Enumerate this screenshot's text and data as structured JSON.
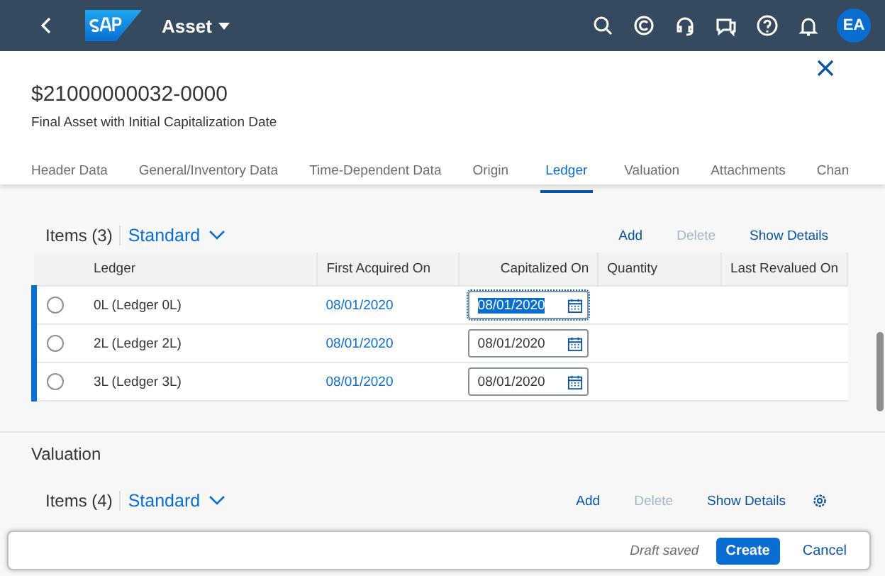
{
  "shell": {
    "app_title": "Asset",
    "avatar": "EA"
  },
  "header": {
    "title": "$21000000032-0000",
    "subtitle": "Final Asset with Initial Capitalization Date"
  },
  "tabs": [
    {
      "label": "Header Data",
      "selected": false
    },
    {
      "label": "General/Inventory Data",
      "selected": false
    },
    {
      "label": "Time-Dependent Data",
      "selected": false
    },
    {
      "label": "Origin",
      "selected": false
    },
    {
      "label": "Ledger",
      "selected": true
    },
    {
      "label": "Valuation",
      "selected": false
    },
    {
      "label": "Attachments",
      "selected": false
    },
    {
      "label": "Chan",
      "selected": false
    }
  ],
  "ledger_table": {
    "count": "Items (3)",
    "variant": "Standard",
    "actions": [
      {
        "label": "Add",
        "disabled": false
      },
      {
        "label": "Delete",
        "disabled": true
      },
      {
        "label": "Show Details",
        "disabled": false
      }
    ],
    "columns": [
      "Ledger",
      "First Acquired On",
      "Capitalized On",
      "Quantity",
      "Last Revalued On"
    ],
    "rows": [
      {
        "selected": false,
        "ledger": "0L (Ledger 0L)",
        "first_acquired_on": "08/01/2020",
        "capitalized_on": "08/01/2020",
        "focused": true
      },
      {
        "selected": false,
        "ledger": "2L (Ledger 2L)",
        "first_acquired_on": "08/01/2020",
        "capitalized_on": "08/01/2020",
        "focused": false
      },
      {
        "selected": false,
        "ledger": "3L (Ledger 3L)",
        "first_acquired_on": "08/01/2020",
        "capitalized_on": "08/01/2020",
        "focused": false
      }
    ]
  },
  "valuation": {
    "title": "Valuation",
    "count": "Items (4)",
    "variant": "Standard",
    "actions": [
      {
        "label": "Add",
        "disabled": false
      },
      {
        "label": "Delete",
        "disabled": true
      },
      {
        "label": "Show Details",
        "disabled": false
      }
    ]
  },
  "footer": {
    "status": "Draft saved",
    "buttons": [
      {
        "label": "Create",
        "kind": "primary"
      },
      {
        "label": "Cancel",
        "kind": "plain"
      }
    ]
  }
}
